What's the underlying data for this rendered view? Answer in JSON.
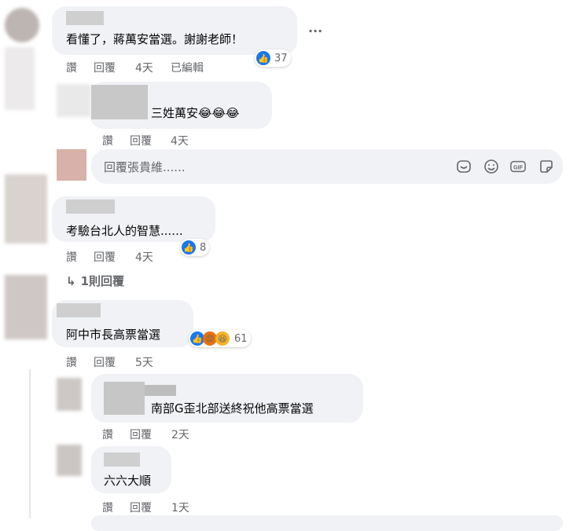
{
  "comments": [
    {
      "text": "看懂了，蔣萬安當選。謝謝老師！",
      "actions": [
        "讚",
        "回覆",
        "4天",
        "已編輯"
      ],
      "reaction_count": "37"
    },
    {
      "text": "三姓萬安😂😂😂",
      "actions": [
        "讚",
        "回覆",
        "4天"
      ]
    },
    {
      "text": "考驗台北人的智慧......",
      "actions": [
        "讚",
        "回覆",
        "4天"
      ],
      "reaction_count": "8"
    },
    {
      "text": "阿中市長高票當選",
      "actions": [
        "讚",
        "回覆",
        "5天"
      ],
      "reaction_count": "61"
    },
    {
      "text": "南部G歪北部送終祝他高票當選",
      "actions": [
        "讚",
        "回覆",
        "2天"
      ]
    },
    {
      "text": "六六大順",
      "actions": [
        "讚",
        "回覆",
        "1天"
      ]
    }
  ],
  "more_options": "···",
  "reply_input": {
    "placeholder": "回覆張貴維......"
  },
  "view_replies": "1則回覆",
  "icons": {
    "sticker": "sticker-icon",
    "emoji": "emoji-icon",
    "gif": "GIF",
    "sticker2": "sticker2-icon"
  },
  "colors": {
    "like": "#1877f2",
    "bubble": "#f0f2f5",
    "meta": "#65676b"
  }
}
